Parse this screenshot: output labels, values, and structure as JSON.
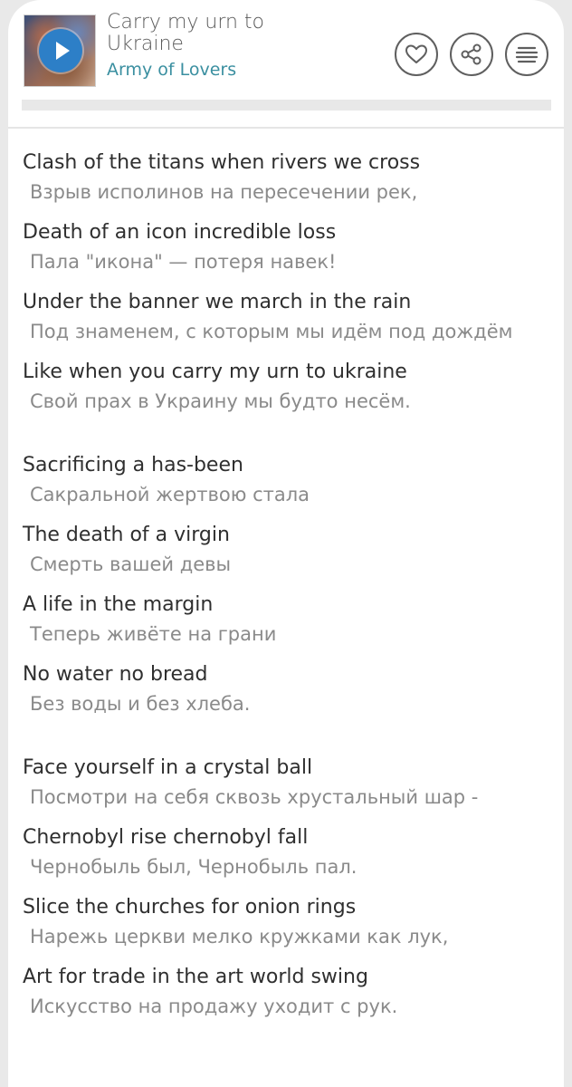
{
  "track": {
    "title": "Carry my urn to Ukraine",
    "artist": "Army of Lovers"
  },
  "icons": {
    "play": "play-icon",
    "favorite": "heart-icon",
    "share": "share-icon",
    "menu": "menu-icon"
  },
  "colors": {
    "accent": "#2d7fc7",
    "artist": "#3a8fa0",
    "lyric_original": "#2f2f2f",
    "lyric_translation": "#8a8a8a"
  },
  "lyrics": [
    {
      "en": "Clash of the titans when rivers we cross",
      "ru": "Взрыв исполинов на пересечении рек,"
    },
    {
      "en": "Death of an icon incredible loss",
      "ru": "Пала \"икона\" — потеря навек!"
    },
    {
      "en": "Under the banner we march in the rain",
      "ru": "Под знаменем, с которым мы идём под дождём"
    },
    {
      "en": "Like when you carry my urn to ukraine",
      "ru": "Свой прах в Украину мы будто несём."
    },
    {
      "en": "Sacrificing a has-been",
      "ru": "Сакральной жертвою стала"
    },
    {
      "en": "The death of a virgin",
      "ru": "Смерть вашей девы"
    },
    {
      "en": "A life in the margin",
      "ru": "Теперь живёте на грани"
    },
    {
      "en": "No water no bread",
      "ru": "Без воды и без хлеба."
    },
    {
      "en": "Face yourself in a crystal ball",
      "ru": "Посмотри на себя сквозь хрустальный шар -"
    },
    {
      "en": "Chernobyl rise chernobyl fall",
      "ru": "Чернобыль был, Чернобыль пал."
    },
    {
      "en": "Slice the churches for onion rings",
      "ru": "Нарежь церкви мелко кружками как лук,"
    },
    {
      "en": "Art for trade in the art world swing",
      "ru": "Искусство на продажу уходит с рук."
    }
  ]
}
